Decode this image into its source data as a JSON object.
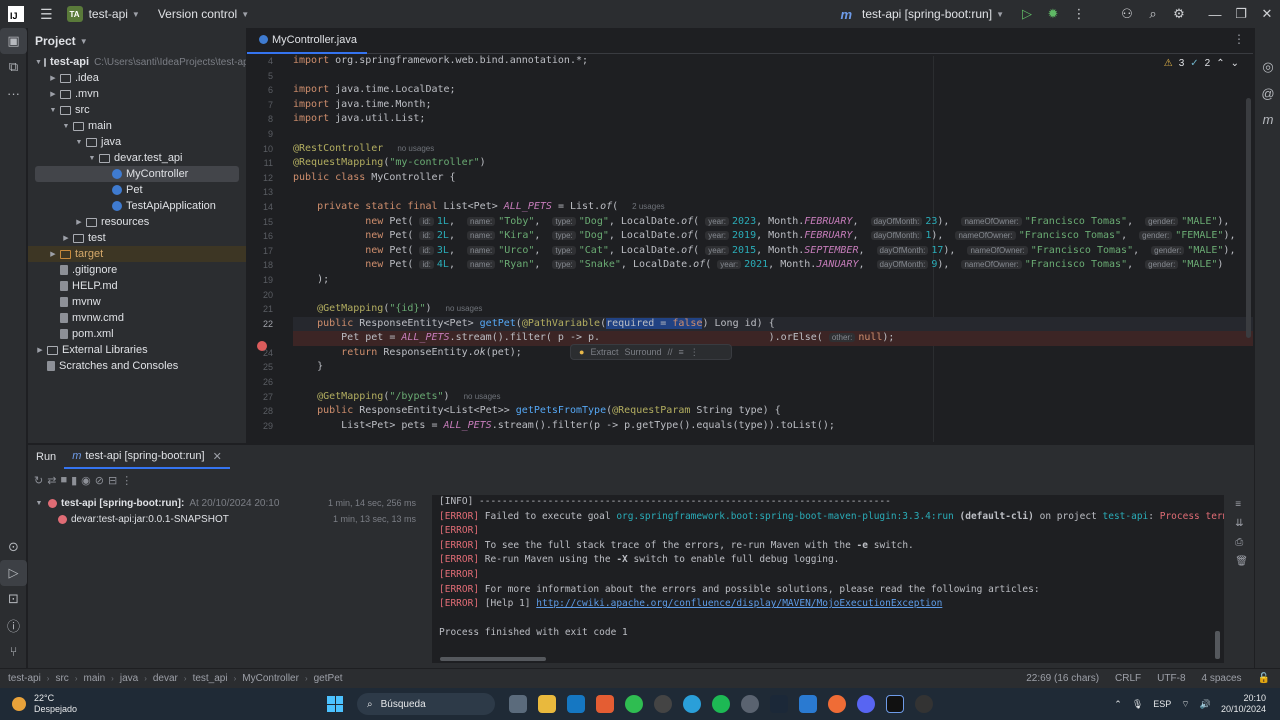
{
  "titlebar": {
    "project_badge": "TA",
    "project_name": "test-api",
    "vcs": "Version control",
    "run_config": "test-api [spring-boot:run]"
  },
  "project_panel": {
    "title": "Project",
    "items": [
      {
        "label": "test-api",
        "path": "C:\\Users\\santi\\IdeaProjects\\test-ap",
        "indent": 0,
        "type": "folder",
        "open": true
      },
      {
        "label": ".idea",
        "indent": 1,
        "type": "folder",
        "open": false
      },
      {
        "label": ".mvn",
        "indent": 1,
        "type": "folder",
        "open": false
      },
      {
        "label": "src",
        "indent": 1,
        "type": "folder",
        "open": true
      },
      {
        "label": "main",
        "indent": 2,
        "type": "folder",
        "open": true
      },
      {
        "label": "java",
        "indent": 3,
        "type": "folder",
        "open": true
      },
      {
        "label": "devar.test_api",
        "indent": 4,
        "type": "folder",
        "open": true
      },
      {
        "label": "MyController",
        "indent": 5,
        "type": "class",
        "selected": true
      },
      {
        "label": "Pet",
        "indent": 5,
        "type": "class"
      },
      {
        "label": "TestApiApplication",
        "indent": 5,
        "type": "class"
      },
      {
        "label": "resources",
        "indent": 3,
        "type": "folder",
        "open": false
      },
      {
        "label": "test",
        "indent": 2,
        "type": "folder",
        "open": false
      },
      {
        "label": "target",
        "indent": 1,
        "type": "folder-orange",
        "open": false,
        "highlight": true
      },
      {
        "label": ".gitignore",
        "indent": 1,
        "type": "file"
      },
      {
        "label": "HELP.md",
        "indent": 1,
        "type": "file"
      },
      {
        "label": "mvnw",
        "indent": 1,
        "type": "file"
      },
      {
        "label": "mvnw.cmd",
        "indent": 1,
        "type": "file"
      },
      {
        "label": "pom.xml",
        "indent": 1,
        "type": "file"
      },
      {
        "label": "External Libraries",
        "indent": 0,
        "type": "lib",
        "open": false
      },
      {
        "label": "Scratches and Consoles",
        "indent": 0,
        "type": "scratch"
      }
    ]
  },
  "editor": {
    "tab": "MyController.java",
    "warnings": "3",
    "weak_warnings": "2",
    "intent_popup": {
      "extract": "Extract",
      "surround": "Surround"
    }
  },
  "run_panel": {
    "tab_run": "Run",
    "tab_config": "test-api [spring-boot:run]",
    "tree": [
      {
        "label": "test-api [spring-boot:run]:",
        "detail": "At 20/10/2024 20:10",
        "time": "1 min, 14 sec, 256 ms"
      },
      {
        "label": "devar:test-api:jar:0.0.1-SNAPSHOT",
        "detail": "",
        "time": "1 min, 13 sec, 13 ms"
      }
    ]
  },
  "statusbar": {
    "crumbs": [
      "test-api",
      "src",
      "main",
      "java",
      "devar",
      "test_api",
      "MyController",
      "getPet"
    ],
    "position": "22:69 (16 chars)",
    "line_sep": "CRLF",
    "encoding": "UTF-8",
    "indent": "4 spaces"
  },
  "taskbar": {
    "temp": "22°C",
    "weather": "Despejado",
    "search": "Búsqueda",
    "lang": "ESP",
    "time": "20:10",
    "date": "20/10/2024"
  }
}
